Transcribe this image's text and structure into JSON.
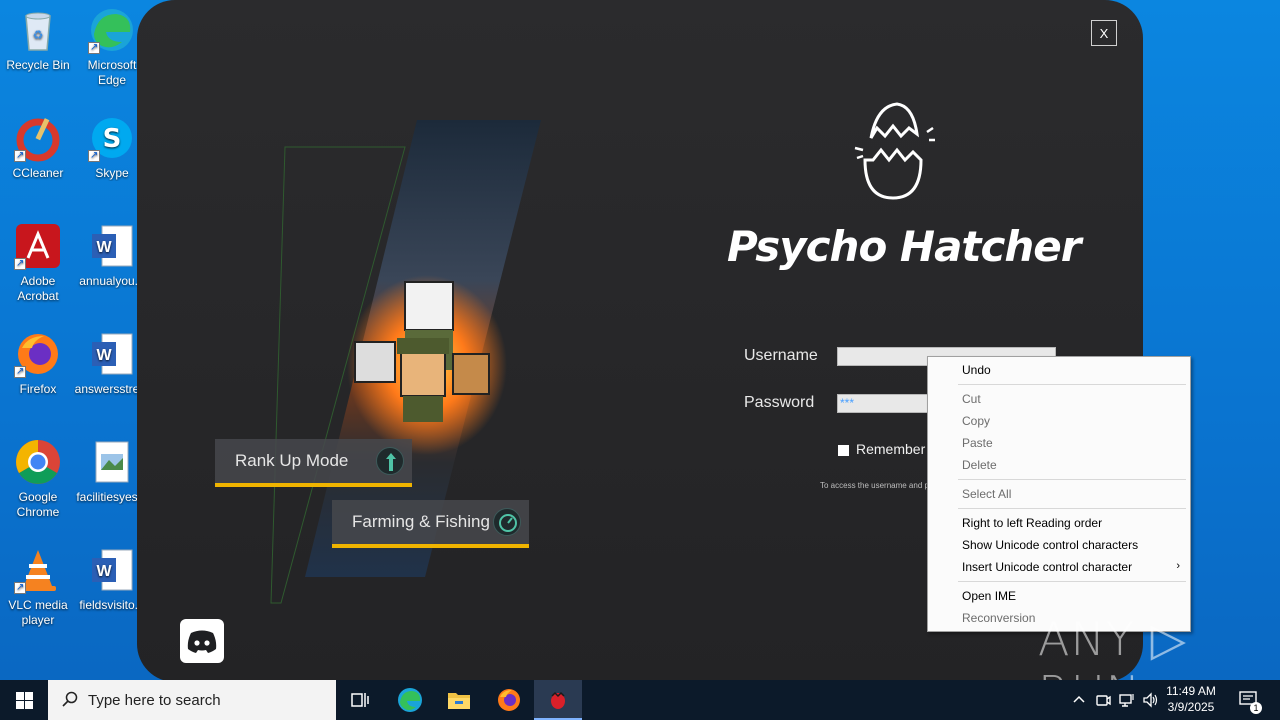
{
  "desktop": {
    "icons": [
      {
        "label_lines": [
          "Recycle Bin"
        ],
        "icon": "recycle-bin-icon"
      },
      {
        "label_lines": [
          "Microsoft",
          "Edge"
        ],
        "icon": "edge-icon"
      },
      {
        "label_lines": [
          "CCleaner"
        ],
        "icon": "ccleaner-icon"
      },
      {
        "label_lines": [
          "Skype"
        ],
        "icon": "skype-icon"
      },
      {
        "label_lines": [
          "Adobe",
          "Acrobat"
        ],
        "icon": "acrobat-icon"
      },
      {
        "label_lines": [
          "annualyou..."
        ],
        "icon": "word-doc-icon"
      },
      {
        "label_lines": [
          "Firefox"
        ],
        "icon": "firefox-icon"
      },
      {
        "label_lines": [
          "answersstre..."
        ],
        "icon": "word-doc-icon"
      },
      {
        "label_lines": [
          "Google",
          "Chrome"
        ],
        "icon": "chrome-icon"
      },
      {
        "label_lines": [
          "facilitiesyes..."
        ],
        "icon": "image-file-icon"
      },
      {
        "label_lines": [
          "VLC media",
          "player"
        ],
        "icon": "vlc-icon"
      },
      {
        "label_lines": [
          "fieldsvisito..."
        ],
        "icon": "word-doc-icon"
      }
    ]
  },
  "app": {
    "close_label": "X",
    "title": "Psycho Hatcher",
    "username_label": "Username",
    "password_label": "Password",
    "username_value": "",
    "password_value": "***",
    "remember_label": "Remember",
    "hint": "To access the username and pa",
    "modes": [
      {
        "label": "Rank Up Mode",
        "icon": "rank-up-arrows-icon"
      },
      {
        "label": "Farming & Fishing",
        "icon": "farming-gauge-icon"
      }
    ],
    "accent_color": "#f0b400"
  },
  "context_menu": {
    "items": [
      {
        "label": "Undo",
        "enabled": true
      },
      {
        "label": "Cut",
        "enabled": false
      },
      {
        "label": "Copy",
        "enabled": false
      },
      {
        "label": "Paste",
        "enabled": false
      },
      {
        "label": "Delete",
        "enabled": false
      },
      {
        "label": "Select All",
        "enabled": false
      },
      {
        "label": "Right to left Reading order",
        "enabled": true
      },
      {
        "label": "Show Unicode control characters",
        "enabled": true
      },
      {
        "label": "Insert Unicode control character",
        "enabled": true,
        "submenu": true
      },
      {
        "label": "Open IME",
        "enabled": true
      },
      {
        "label": "Reconversion",
        "enabled": false
      }
    ],
    "submenu_arrow": "›"
  },
  "watermark": "ANY ▷ RUN",
  "taskbar": {
    "search_placeholder": "Type here to search",
    "clock_time": "11:49 AM",
    "clock_date": "3/9/2025",
    "notification_count": "1",
    "pinned": [
      "task-view-icon",
      "edge-icon",
      "file-explorer-icon",
      "firefox-icon",
      "psycho-hatcher-icon"
    ]
  }
}
